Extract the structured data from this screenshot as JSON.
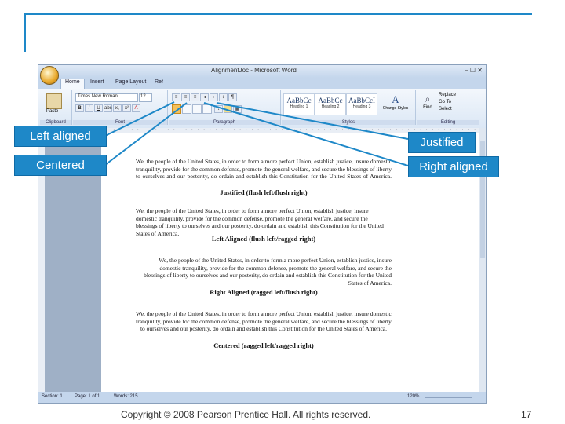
{
  "window": {
    "title": "AlignmentJoc - Microsoft Word",
    "controls": "– ☐ ✕",
    "tabs": [
      "Home",
      "Insert",
      "Page Layout",
      "Ref"
    ]
  },
  "ribbon": {
    "font_name": "Times New Roman",
    "font_size": "12",
    "group_clipboard": "Clipboard",
    "group_font": "Font",
    "group_paragraph": "Paragraph",
    "group_styles": "Styles",
    "group_editing": "Editing",
    "paste_label": "Paste",
    "style_samples": [
      "AaBbCc",
      "AaBbCc",
      "AaBbCcI"
    ],
    "style_names": [
      "Heading 1",
      "Heading 2",
      "Heading 3"
    ],
    "change_styles_label": "Change Styles",
    "find_label": "Find",
    "replace_label": "Replace",
    "goto_label": "Go To",
    "select_label": "Select"
  },
  "statusbar": {
    "section": "Section: 1",
    "page": "Page: 1 of 1",
    "words": "Words: 215",
    "zoom": "120%"
  },
  "document": {
    "para_justified": "We, the people of the United States, in order to form a more perfect Union, establish justice, insure domestic tranquility, provide for the common defense, promote the general welfare, and secure the blessings of liberty to ourselves and our posterity, do ordain and establish this Constitution for the United States of America.",
    "caption_justified": "Justified (flush left/flush right)",
    "para_left": "We, the people of the United States, in order to form a more perfect Union, establish justice, insure domestic tranquility, provide for the common defense, promote the general welfare, and secure the blessings of liberty to ourselves and our posterity, do ordain and establish this Constitution for the United States of America.",
    "caption_left": "Left Aligned (flush left/ragged right)",
    "para_right": "We, the people of the United States, in order to form a more perfect Union, establish justice, insure domestic tranquility, provide for the common defense, promote the general welfare, and secure the blessings of liberty to ourselves and our posterity, do ordain and establish this Constitution for the United States of America.",
    "caption_right": "Right Aligned (ragged left/flush right)",
    "para_center": "We, the people of the United States, in order to form a more perfect Union, establish justice, insure domestic tranquility, provide for the common defense, promote the general welfare, and secure the blessings of liberty to ourselves and our posterity, do ordain and establish this Constitution for the United States of America.",
    "caption_center": "Centered (ragged left/ragged right)"
  },
  "callouts": {
    "left_aligned": "Left aligned",
    "centered": "Centered",
    "justified": "Justified",
    "right_aligned": "Right aligned"
  },
  "footer": {
    "copyright": "Copyright © 2008 Pearson Prentice Hall. All rights reserved.",
    "page_number": "17"
  },
  "colors": {
    "accent": "#1e88c8",
    "callout_text": "#ffffff"
  }
}
